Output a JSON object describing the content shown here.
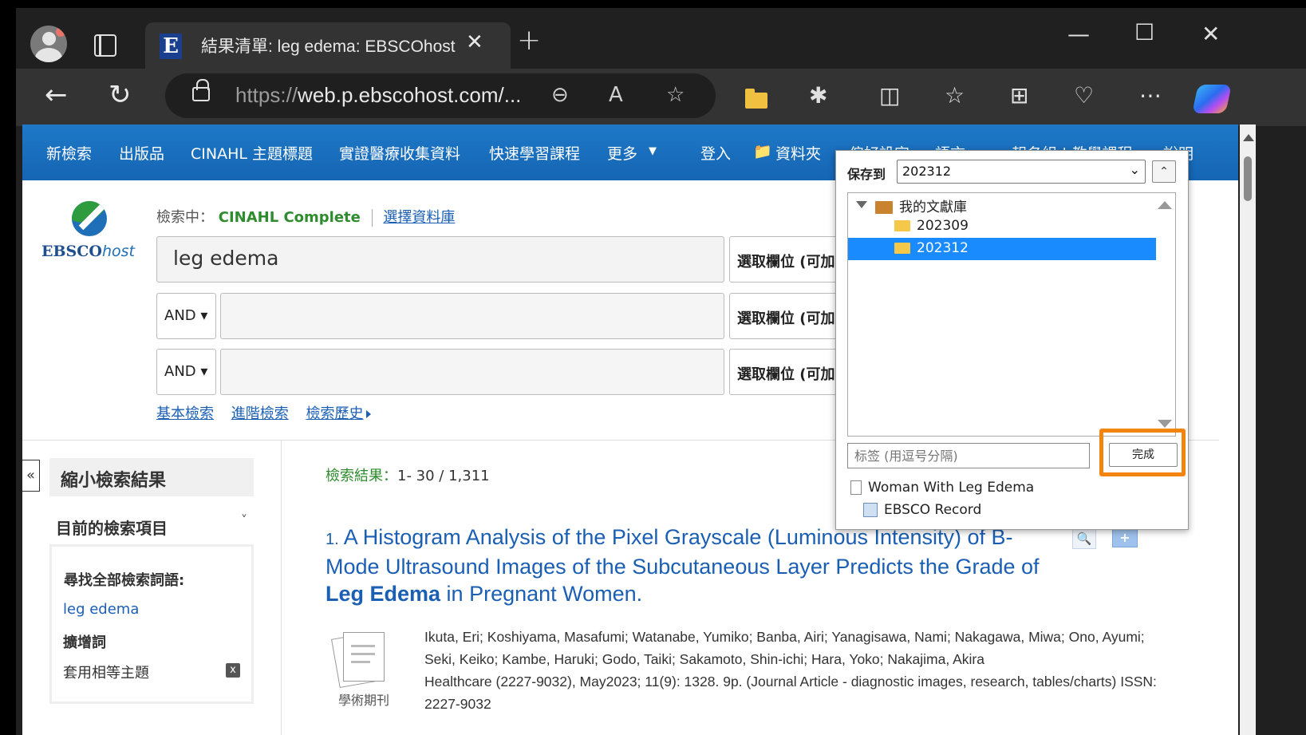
{
  "browser": {
    "tab_title": "結果清單: leg edema: EBSCOhost",
    "tab_favicon": "E",
    "url_scheme": "https://",
    "url_host": "web.p.ebscohost.com/...",
    "icons": [
      "profile-icon",
      "tab-actions-icon",
      "close-icon",
      "new-tab-icon",
      "minimize-icon",
      "maximize-icon",
      "window-close-icon",
      "back-icon",
      "refresh-icon",
      "lock-icon",
      "zoom-icon",
      "read-aloud-icon",
      "favorite-star-icon",
      "folder-icon",
      "extensions-icon",
      "split-screen-icon",
      "favorites-icon",
      "collections-icon",
      "health-icon",
      "more-icon",
      "copilot-icon"
    ]
  },
  "topnav": {
    "items": [
      "新檢索",
      "出版品",
      "CINAHL 主題標題",
      "實證醫療收集資料",
      "快速學習課程",
      "更多"
    ],
    "signin": "登入",
    "folder": "資料夾",
    "prefs": "偏好設定",
    "lang": "語言",
    "org": "報名組 | 教學課程",
    "help": "說明"
  },
  "search": {
    "searching_label": "檢索中：",
    "database": "CINAHL Complete",
    "choose_db": "選擇資料庫",
    "query": "leg edema",
    "field_label": "選取欄位 (可加",
    "bool": "AND",
    "basic": "基本檢索",
    "advanced": "進階檢索",
    "history": "檢索歷史"
  },
  "logo": {
    "name": "EBSCO",
    "suffix": "host"
  },
  "sidebar": {
    "collapse": "«",
    "refine": "縮小檢索結果",
    "current": "目前的檢索項目",
    "find_all": "尋找全部檢索詞語:",
    "term": "leg edema",
    "expanders": "擴增詞",
    "equiv": "套用相等主題",
    "remove": "x"
  },
  "results": {
    "count_label": "檢索結果：",
    "range": "1- 30 / 1,311",
    "item1": {
      "num": "1.",
      "title_a": "A Histogram Analysis of the Pixel Grayscale (Luminous Intensity) of B-Mode Ultrasound Images of the Subcutaneous Layer Predicts the Grade of ",
      "title_b": "Leg Edema",
      "title_c": " in Pregnant Women.",
      "authors": "Ikuta, Eri; Koshiyama, Masafumi; Watanabe, Yumiko; Banba, Airi; Yanagisawa, Nami; Nakagawa, Miwa; Ono, Ayumi; Seki, Keiko; Kambe, Haruki; Godo, Taiki; Sakamoto, Shin-ichi; Hara, Yoko; Nakajima, Akira",
      "source": "Healthcare (2227-9032), May2023; 11(9): 1328. 9p. (Journal Article - diagnostic images, research, tables/charts) ISSN: 2227-9032",
      "type": "學術期刊"
    }
  },
  "dialog": {
    "save_to": "保存到",
    "selected": "202312",
    "library": "我的文獻庫",
    "folders": [
      "202309",
      "202312"
    ],
    "tag_placeholder": "标签 (用逗号分隔)",
    "done": "完成",
    "items": [
      "Woman With Leg Edema",
      "EBSCO Record"
    ]
  }
}
